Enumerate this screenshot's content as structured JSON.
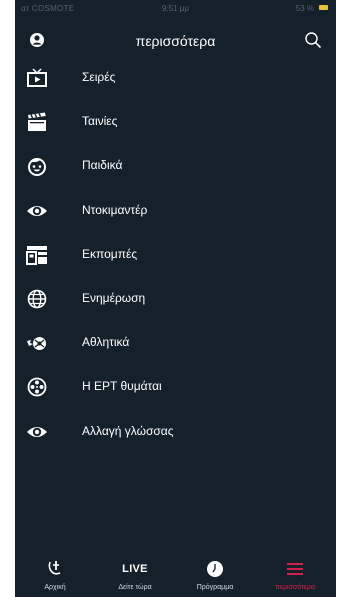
{
  "status_bar": {
    "carrier": "ατ COSMOTE",
    "time": "9:51 μμ",
    "battery": "53 %"
  },
  "header": {
    "title": "περισσότερα"
  },
  "menu": {
    "items": [
      {
        "label": "Σειρές",
        "icon": "tv-play-icon"
      },
      {
        "label": "Ταινίες",
        "icon": "clapperboard-icon"
      },
      {
        "label": "Παιδικά",
        "icon": "kid-face-icon"
      },
      {
        "label": "Ντοκιμαντέρ",
        "icon": "eye-icon"
      },
      {
        "label": "Εκπομπές",
        "icon": "shows-icon"
      },
      {
        "label": "Ενημέρωση",
        "icon": "globe-icon"
      },
      {
        "label": "Αθλητικά",
        "icon": "sports-icon"
      },
      {
        "label": "Η ΕΡΤ θυμάται",
        "icon": "film-reel-icon"
      },
      {
        "label": "Αλλαγή γλώσσας",
        "icon": "eye-icon"
      }
    ]
  },
  "tabbar": {
    "tabs": [
      {
        "label": "Αρχική",
        "icon": "ert-logo-icon"
      },
      {
        "label": "Δείτε τώρα",
        "icon_text": "LIVE"
      },
      {
        "label": "Πρόγραμμα",
        "icon": "clock-icon"
      },
      {
        "label": "περισσότερα",
        "icon": "hamburger-icon",
        "active": true
      }
    ],
    "active_color": "#d3204f"
  },
  "colors": {
    "background": "#14212b",
    "text": "#ffffff",
    "accent": "#d3204f"
  }
}
